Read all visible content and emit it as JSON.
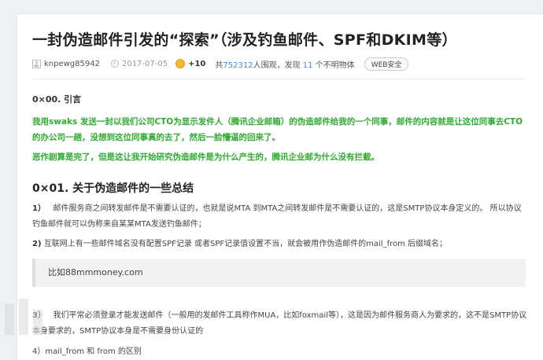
{
  "article": {
    "title": "一封伪造邮件引发的“探索”（涉及钓鱼邮件、SPF和DKIM等）",
    "meta": {
      "author": "knpewg85942",
      "date": "2017-07-05",
      "coins": "+10",
      "views_prefix": "共",
      "views": "752312",
      "views_suffix": "人围观，发现",
      "found": "11",
      "found_suffix": "个不明物体",
      "tag": "WEB安全"
    },
    "intro_heading": "0×00. 引言",
    "green_p1": "我用swaks 发送一封以我们公司CTO为显示发件人（腾讯企业邮箱）的伪造邮件给我的一个同事，邮件的内容就是让这位同事去CTO的办公司一趟，没想到这位同事真的去了，然后一脸懵逼的回来了。",
    "green_p2": "恶作剧算是完了，但是这让我开始研究伪造邮件是为什么产生的，腾讯企业邮为什么没有拦截。",
    "section1_heading": "0×01. 关于伪造邮件的一些总结",
    "p3_num": "1）",
    "p3_text": "邮件服务商之间转发邮件是不需要认证的，也就是说MTA 到MTA之间转发邮件是不需要认证的，这是SMTP协议本身定义的。 所以协议钓鱼邮件就可以伪称来自某某MTA发送钓鱼邮件；",
    "p4_num": "2)",
    "p4_text": "互联网上有一些邮件域名没有配置SPF记录 或者SPF记录值设置不当，就会被用作伪造邮件的mail_from 后缀域名；",
    "code_text": "比如88mmmoney.com",
    "p5_num": "3）",
    "p5_text": "我们平常必须登录才能发送邮件（一般用的发邮件工具称作MUA，比如foxmail等），这是因为邮件服务商人为要求的，这不是SMTP协议本身要求的，SMTP协议本身是不需要身份认证的",
    "p6_text": "4）mail_from 和 from 的区别"
  },
  "colors": {
    "green": "#2eab30",
    "link": "#3a8ee6"
  },
  "icons": [
    "author-icon",
    "clock-icon",
    "coin-icon",
    "watermark-logo"
  ]
}
